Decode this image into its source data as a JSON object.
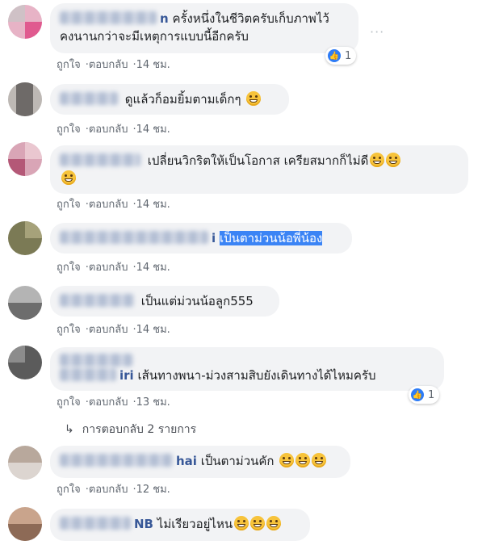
{
  "comments": [
    {
      "name_tail": "n",
      "text": "ครั้งหนึ่งในชีวิตครับเก็บภาพไว้",
      "text2": "คงนานกว่าจะมีเหตุการแบบนี้อีกครับ",
      "like": "ถูกใจ",
      "reply": "ตอบกลับ",
      "time": "14 ชม.",
      "reactions": "1"
    },
    {
      "name_tail": "",
      "text": "ดูแล้วก็อมยิ้มตามเด็กๆ",
      "like": "ถูกใจ",
      "reply": "ตอบกลับ",
      "time": "14 ชม."
    },
    {
      "name_tail": "",
      "text": "เปลี่ยนวิกริตให้เป็นโอกาส เครียสมากก็ไม่ดี",
      "like": "ถูกใจ",
      "reply": "ตอบกลับ",
      "time": "14 ชม."
    },
    {
      "name_tail": "i",
      "text": "เป็นตาม่วนน้อพี่น้อง",
      "like": "ถูกใจ",
      "reply": "ตอบกลับ",
      "time": "14 ชม."
    },
    {
      "name_tail": "",
      "text": "เป็นแต่ม่วนน้อลูก555",
      "like": "ถูกใจ",
      "reply": "ตอบกลับ",
      "time": "14 ชม."
    },
    {
      "name_tail": "iri",
      "text": "เส้นทางพนา-ม่วงสามสิบยังเดินทางได้ไหมครับ",
      "like": "ถูกใจ",
      "reply": "ตอบกลับ",
      "time": "13 ชม.",
      "reactions": "1"
    },
    {
      "name_tail": "hai",
      "text": "เป็นตาม่วนคัก",
      "like": "ถูกใจ",
      "reply": "ตอบกลับ",
      "time": "12 ชม."
    },
    {
      "name_tail": "NB",
      "text": "ไม่เรียวอยู่ไหน"
    }
  ],
  "replies_link": "การตอบกลับ 2 รายการ",
  "more_glyph": "···",
  "dot": "·",
  "like_glyph": "👍",
  "arrow_glyph": "↳"
}
